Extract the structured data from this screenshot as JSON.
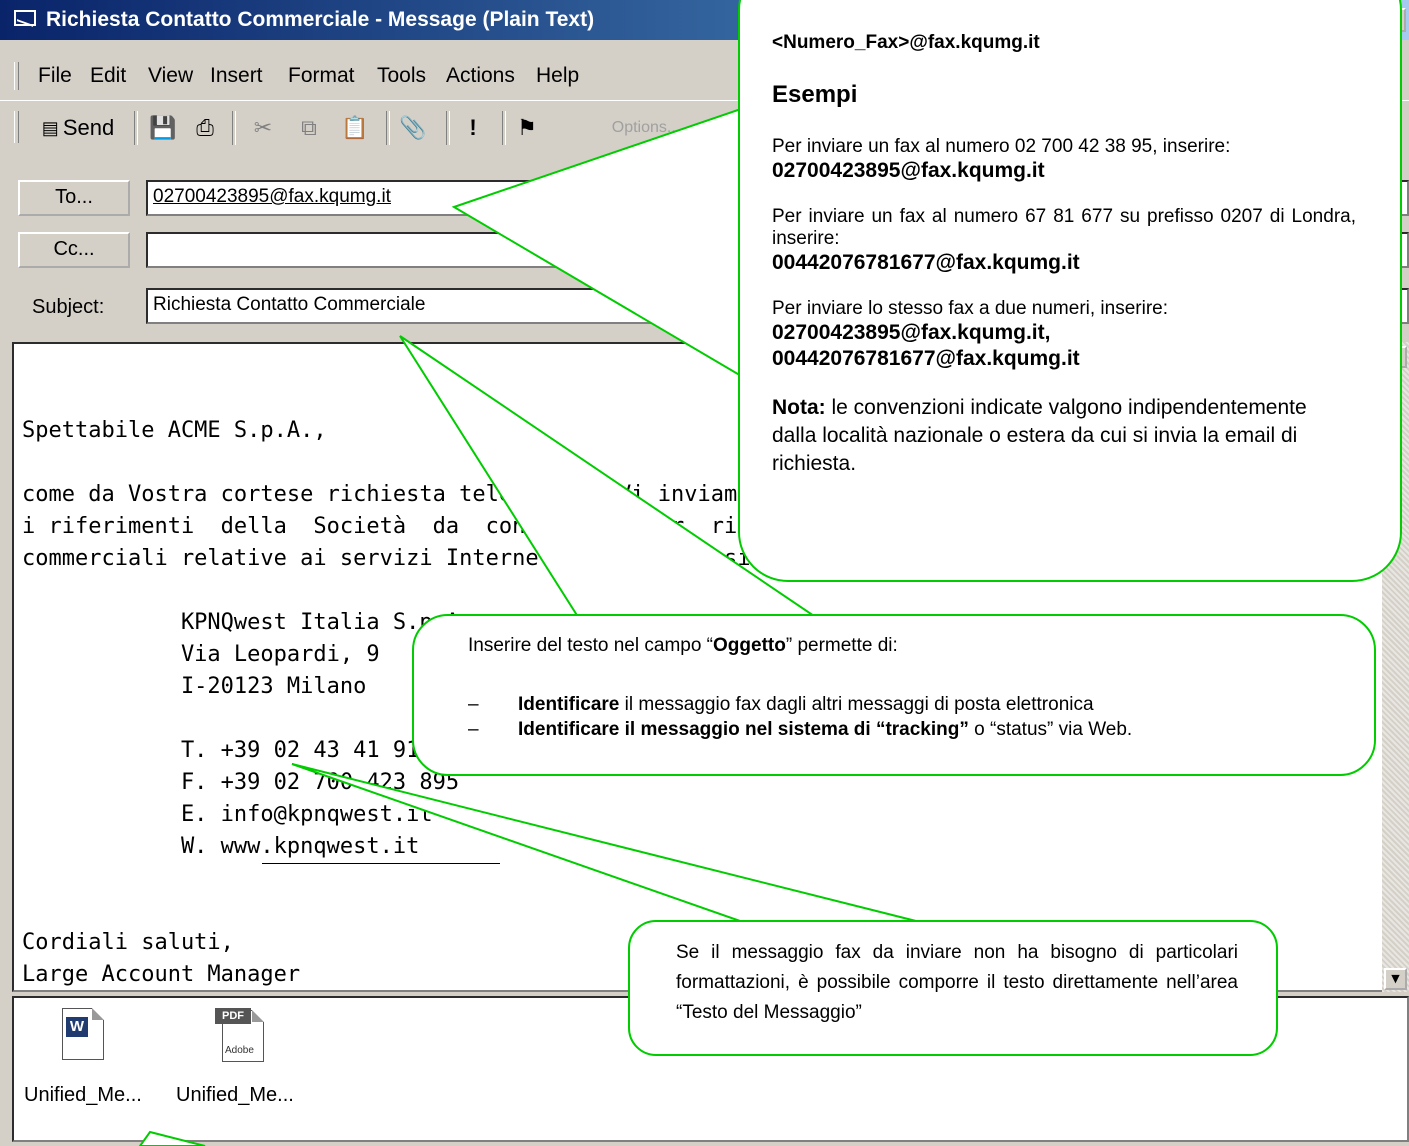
{
  "window": {
    "title": "Richiesta Contatto Commerciale - Message (Plain Text)"
  },
  "menu": [
    "File",
    "Edit",
    "View",
    "Insert",
    "Format",
    "Tools",
    "Actions",
    "Help"
  ],
  "toolbar": {
    "send_label": "Send",
    "options_label": "Options..."
  },
  "header": {
    "to_label": "To...",
    "to_value": "02700423895@fax.kqumg.it",
    "cc_label": "Cc...",
    "cc_value": "",
    "subject_label": "Subject:",
    "subject_value": "Richiesta Contatto Commerciale"
  },
  "body": {
    "lines": [
      "Spettabile ACME S.p.A.,",
      "come da Vostra cortese richiesta telefonica, Vi inviamo con la presente",
      "i riferimenti  della  Società  da  contattare  per  ricevere informazioni",
      "commerciali relative ai servizi Internet di cui necessitate :",
      "            KPNQwest Italia S.p.A.",
      "            Via Leopardi, 9",
      "            I-20123 Milano",
      "            T. +39 02 43 41 91",
      "            F. +39 02 700 423 895",
      "            E. info@kpnqwest.it",
      "            W. www.kpnqwest.it",
      "Cordiali saluti,",
      "Large Account Manager"
    ]
  },
  "attachments": [
    {
      "name": "Unified_Me...",
      "type": "W"
    },
    {
      "name": "Unified_Me...",
      "type": "PDF",
      "sub": "Adobe"
    }
  ],
  "callout_format": {
    "fax_prefix": "<",
    "fax_var": "Numero_Fax",
    "fax_suffix": ">@fax.kqumg.it",
    "title": "Esempi",
    "ex1_text": "Per inviare un fax al numero 02 700 42 38 95, inserire:",
    "ex1_addr": "02700423895@fax.kqumg.it",
    "ex2_text": "Per inviare un fax al numero 67 81 677 su prefisso 0207 di Londra, inserire:",
    "ex2_addr": "00442076781677@fax.kqumg.it",
    "ex3_text": "Per inviare lo stesso fax a due numeri, inserire:",
    "ex3_addr1": "02700423895@fax.kqumg.it,",
    "ex3_addr2": "00442076781677@fax.kqumg.it",
    "note_label": "Nota:",
    "note_text": " le convenzioni indicate valgono indipendentemente dalla località nazionale o estera da cui si invia la email di richiesta."
  },
  "callout_subject": {
    "intro_pre": "Inserire del testo nel campo “",
    "intro_bold": "Oggetto",
    "intro_post": "” permette di:",
    "bullet1_bold": "Identificare",
    "bullet1_text": " il messaggio fax dagli altri messaggi di posta elettronica",
    "bullet2_bold": "Identificare il messaggio nel sistema di “tracking”",
    "bullet2_text": " o “status” via Web."
  },
  "callout_body": {
    "text": "Se il messaggio fax da inviare non ha bisogno di particolari formattazioni, è possibile comporre il testo direttamente nell’area “Testo del Messaggio”"
  },
  "colors": {
    "callout_border": "#00cc00",
    "titlebar": "#0a246a"
  }
}
